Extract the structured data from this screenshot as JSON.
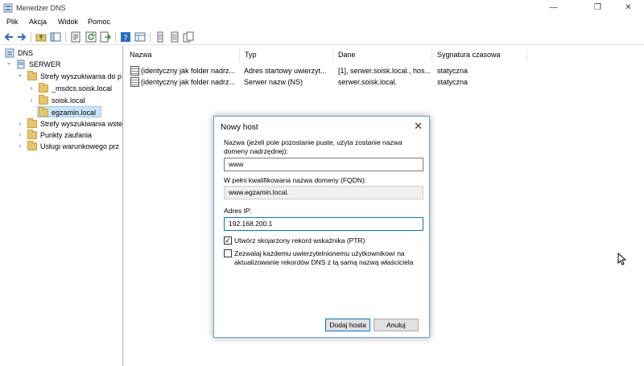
{
  "window": {
    "title": "Menedżer DNS"
  },
  "window_buttons": {
    "minimize": "—",
    "restore": "❐",
    "close": "✕"
  },
  "menu": [
    "Plik",
    "Akcja",
    "Widok",
    "Pomoc"
  ],
  "toolbar": {
    "icons": [
      "back-icon",
      "forward-icon",
      "folder-up-icon",
      "show-tree-icon",
      "properties-icon",
      "refresh-icon",
      "export-icon",
      "help-icon",
      "view-icon",
      "record-icon",
      "record-list-icon",
      "copy-icon"
    ]
  },
  "tree": {
    "items": [
      {
        "label": "DNS",
        "expander": ""
      },
      {
        "label": "SERWER",
        "expander": "⌄"
      },
      {
        "label": "Strefy wyszukiwania do p",
        "expander": "⌄"
      },
      {
        "label": "_msdcs.soisk.local",
        "expander": "›"
      },
      {
        "label": "soisk.local",
        "expander": "›"
      },
      {
        "label": "egzamin.local",
        "expander": ""
      },
      {
        "label": "Strefy wyszukiwania wste",
        "expander": "›"
      },
      {
        "label": "Punkty zaufania",
        "expander": "›"
      },
      {
        "label": "Usługi warunkowego prz",
        "expander": "›"
      }
    ]
  },
  "list": {
    "columns": [
      "Nazwa",
      "Typ",
      "Dane",
      "Sygnatura czasowa"
    ],
    "rows": [
      {
        "name": "(identyczny jak folder nadrz...",
        "type": "Adres startowy uwierzyt...",
        "data": "[1], serwer.soisk.local., hos...",
        "timestamp": "statyczna"
      },
      {
        "name": "(identyczny jak folder nadrz...",
        "type": "Serwer nazw (NS)",
        "data": "serwer.soisk.local.",
        "timestamp": "statyczna"
      }
    ]
  },
  "dialog": {
    "title": "Nowy host",
    "close": "✕",
    "name_label": "Nazwa (jeżeli pole pozostanie puste, użyta zostanie nazwa domeny nadrzędnej):",
    "name_value": "www",
    "fqdn_label": "W pełni kwalifikowana nazwa domeny (FQDN):",
    "fqdn_value": "www.egzamin.local.",
    "ip_label": "Adres IP:",
    "ip_value": "192.168.200.1",
    "ptr_label": "Utwórz skojarzony rekord wskaźnika (PTR)",
    "ptr_checked": true,
    "check_mark": "✓",
    "auth_label": "Zezwalaj każdemu uwierzytelnionemu użytkownikowi na aktualizowanie rekordów DNS z tą samą nazwą właściciela",
    "auth_checked": false,
    "add_button": "Dodaj hosta",
    "cancel_button": "Anuluj"
  }
}
